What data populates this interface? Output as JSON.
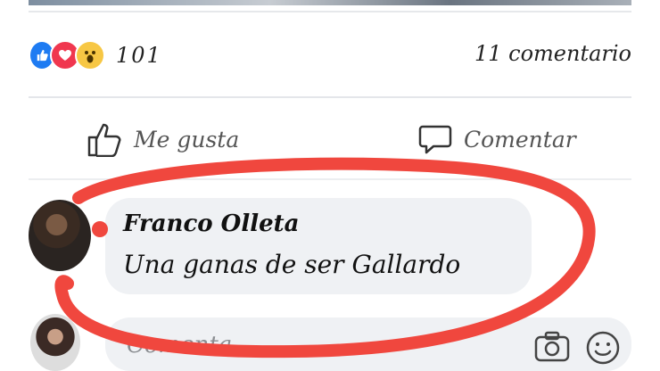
{
  "reactions": {
    "icons": [
      "like-icon",
      "love-icon",
      "wow-icon"
    ],
    "count": "101"
  },
  "comments_count": "11 comentario",
  "actions": {
    "like_label": "Me gusta",
    "comment_label": "Comentar"
  },
  "comment": {
    "author": "Franco Olleta",
    "text": "Una ganas de ser Gallardo"
  },
  "composer": {
    "placeholder": "Comenta..."
  },
  "colors": {
    "annotation": "#f0473e",
    "like": "#1e7bf2",
    "love": "#f0374f",
    "wow": "#f7c744",
    "bubble": "#eff1f4"
  }
}
